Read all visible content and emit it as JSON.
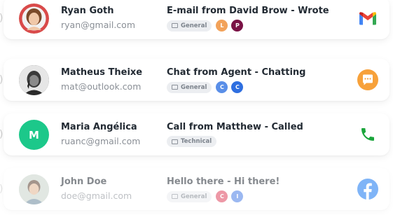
{
  "rows": [
    {
      "name": "Ryan Goth",
      "email": "ryan@gmail.com",
      "subject": "E-mail from David Brow - Wrote",
      "category": "General",
      "agents": [
        {
          "initial": "L",
          "color": "#f2a25a"
        },
        {
          "initial": "P",
          "color": "#7a1245"
        }
      ],
      "channel_icon": "gmail-icon",
      "avatar_color": "#e8c9b5"
    },
    {
      "name": "Matheus Theixe",
      "email": "mat@outlook.com",
      "subject": "Chat from Agent - Chatting",
      "category": "General",
      "agents": [
        {
          "initial": "C",
          "color": "#5a8fe8"
        },
        {
          "initial": "C",
          "color": "#2f6fe0"
        }
      ],
      "channel_icon": "chat-icon",
      "avatar_color": "#4a4a4a"
    },
    {
      "name": "Maria Angélica",
      "email": "ruanc@gmail.com",
      "subject": "Call from Matthew - Called",
      "category": "Technical",
      "agents": [],
      "channel_icon": "phone-icon",
      "avatar_initial": "M",
      "avatar_color": "#1cc88a"
    },
    {
      "name": "John Doe",
      "email": "doe@gmail.com",
      "subject": "Hello there - Hi there!",
      "category": "General",
      "agents": [
        {
          "initial": "C",
          "color": "#e0455e"
        },
        {
          "initial": "I",
          "color": "#4a7fe6"
        }
      ],
      "channel_icon": "facebook-icon",
      "avatar_color": "#b9c7c0"
    }
  ],
  "colors": {
    "gmail_red": "#ea4335",
    "gmail_blue": "#4285f4",
    "gmail_green": "#34a853",
    "gmail_yellow": "#fbbc05",
    "chat_orange": "#f7a13a",
    "phone_green": "#1aa53b",
    "facebook_blue": "#1877f2"
  }
}
